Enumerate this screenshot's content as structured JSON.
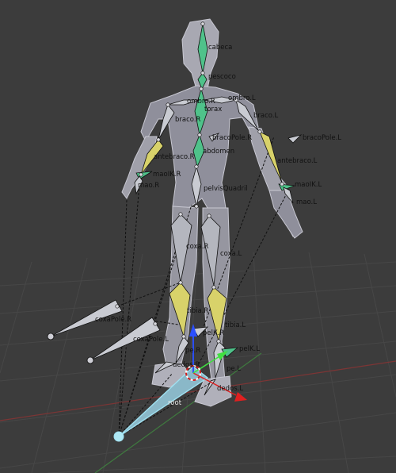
{
  "viewport": {
    "background": "#3c3c3c",
    "grid_color": "#464646",
    "x_axis_color": "#8a3030",
    "y_axis_color": "#3d7a3d"
  },
  "bone_labels": {
    "cabeca": "cabeca",
    "pescoco": "pescoco",
    "ombro_r": "ombro.R",
    "ombro_l": "ombro.L",
    "torax": "torax",
    "braco_r": "braco.R",
    "braco_l": "braco.L",
    "bracopole_r": "bracoPole.R",
    "bracopole_l": "bracoPole.L",
    "abdomen": "abdomen",
    "antebraco_r": "antebraco.R",
    "antebraco_l": "antebraco.L",
    "maoik_r": "maoIK.R",
    "maoik_l": "maoIK.L",
    "mao_r": "mao.R",
    "mao_l": "mao.L",
    "pelvisquadril": "pelvisQuadril",
    "coxa_r": "coxa.R",
    "coxa_l": "coxa.L",
    "coxapole_r": "coxaPole.R",
    "coxapole_l": "coxaPole.L",
    "tibia_r": "tibia.R",
    "tibia_l": "tibia.L",
    "pelk_r": "pelK.R",
    "pelk_l": "pelK.L",
    "pe_r": "pe.R",
    "pe_l": "pe.L",
    "dedos_r": "dedos.R",
    "dedos_l": "dedos.L",
    "root": "root"
  },
  "bone_colors": {
    "deform": "#c9cbd2",
    "spine": "#4fc28a",
    "ik_yellow": "#d8d26a",
    "selected": "#9fe0f0",
    "gizmo_z": "#2b4fff",
    "gizmo_x": "#e02020",
    "gizmo_y": "#40e040"
  }
}
